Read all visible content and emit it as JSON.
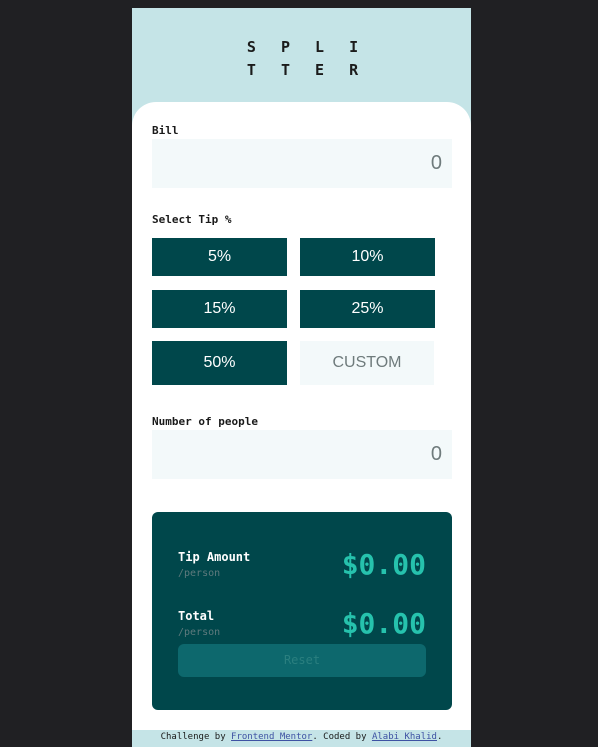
{
  "logo": {
    "line1": "S P L I",
    "line2": "T T E R"
  },
  "bill": {
    "label": "Bill",
    "value": "0"
  },
  "tip": {
    "label": "Select Tip %",
    "options": [
      "5%",
      "10%",
      "15%",
      "25%",
      "50%"
    ],
    "custom_placeholder": "CUSTOM"
  },
  "people": {
    "label": "Number of people",
    "value": "0"
  },
  "results": {
    "tip_label": "Tip Amount",
    "tip_sub": "/person",
    "tip_value": "$0.00",
    "total_label": "Total",
    "total_sub": "/person",
    "total_value": "$0.00",
    "reset_label": "Reset"
  },
  "footer": {
    "prefix": "Challenge by ",
    "link1": "Frontend Mentor",
    "middle": ". Coded by ",
    "link2": "Alabi Khalid",
    "suffix": "."
  }
}
